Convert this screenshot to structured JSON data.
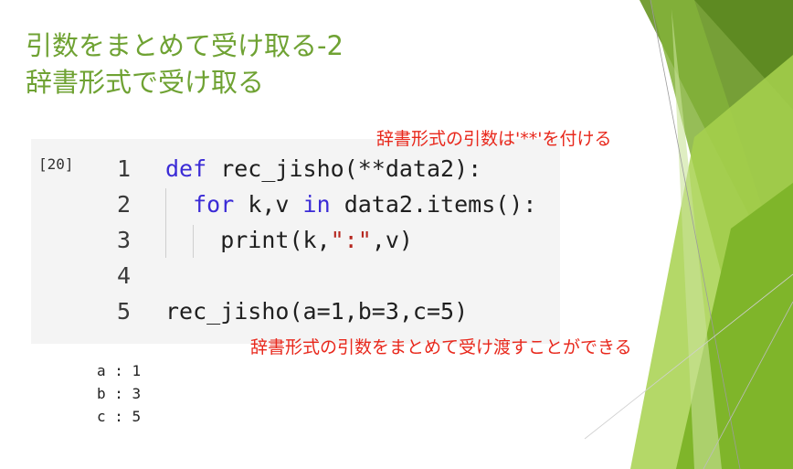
{
  "slide": {
    "title_line1": "引数をまとめて受け取る-2",
    "title_line2": "辞書形式で受け取る",
    "accent_color": "#6fa233"
  },
  "cell": {
    "prompt": "[20]",
    "lines": [
      {
        "no": "1",
        "parts": [
          {
            "t": "def",
            "c": "kw"
          },
          {
            "t": " rec_jisho(**data2):",
            "c": "fn"
          }
        ]
      },
      {
        "no": "2",
        "parts": [
          {
            "t": "  "
          },
          {
            "t": "for",
            "c": "kw"
          },
          {
            "t": " k,v ",
            "c": "fn"
          },
          {
            "t": "in",
            "c": "kw"
          },
          {
            "t": " data2.items():",
            "c": "fn"
          }
        ]
      },
      {
        "no": "3",
        "parts": [
          {
            "t": "    print(k,",
            "c": "fn"
          },
          {
            "t": "\":\"",
            "c": "str"
          },
          {
            "t": ",v)",
            "c": "fn"
          }
        ]
      },
      {
        "no": "4",
        "parts": []
      },
      {
        "no": "5",
        "parts": [
          {
            "t": "rec_jisho(a=1,b=3,c=5)",
            "c": "fn"
          }
        ]
      }
    ]
  },
  "annotations": {
    "top": "辞書形式の引数は'**'を付ける",
    "bottom": "辞書形式の引数をまとめて受け渡すことができる",
    "color": "#e8281c"
  },
  "output": [
    "a : 1",
    "b : 3",
    "c : 5"
  ]
}
